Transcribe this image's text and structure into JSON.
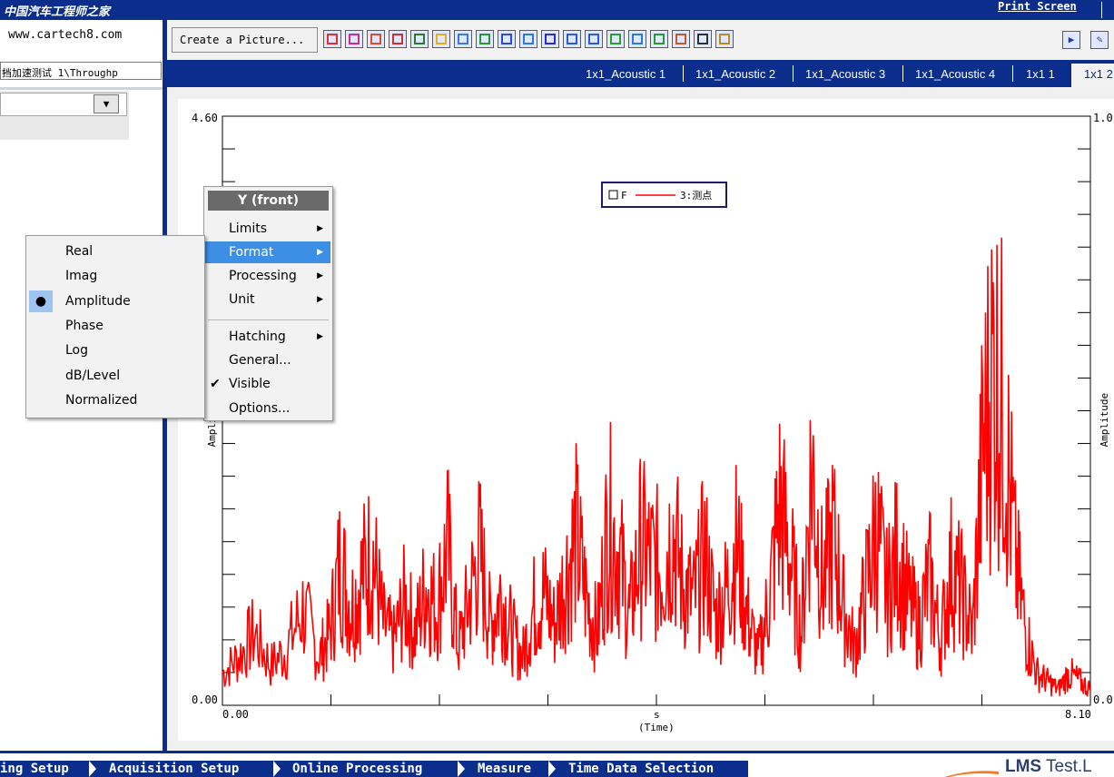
{
  "header": {
    "logo_text": "中国汽车工程师之家",
    "print_screen_label": "Print Screen"
  },
  "left_panel": {
    "site_url": "www.cartech8.com",
    "project_select_value": "挡加速测试 1\\Throughp"
  },
  "toolbar": {
    "create_picture_label": "Create a Picture...",
    "icons": [
      "line-graph-icon",
      "graph-2-icon",
      "circle-graph-icon",
      "polar-icon",
      "image-icon",
      "bar-3d-icon",
      "waterfall-icon",
      "list-icon",
      "flag-icon",
      "value-icon",
      "grid-icon",
      "axis-icon",
      "axis-2-icon",
      "palette-icon",
      "gauge-icon",
      "bar-chart-icon",
      "tools-icon",
      "bus-icon",
      "brush-icon"
    ],
    "right_icons": [
      "play-icon",
      "new-window-icon"
    ]
  },
  "tabs": [
    {
      "label": "1x1_Acoustic 1"
    },
    {
      "label": "1x1_Acoustic 2"
    },
    {
      "label": "1x1_Acoustic 3"
    },
    {
      "label": "1x1_Acoustic 4"
    },
    {
      "label": "1x1 1"
    },
    {
      "label": "1x1 2",
      "active": true
    }
  ],
  "chart_data": {
    "type": "line",
    "title": "",
    "xlabel_unit": "s",
    "xlabel": "(Time)",
    "ylabel": "Amplitude",
    "ylabel_right": "Amplitude",
    "x_tick_labels": [
      "0.00",
      "8.10"
    ],
    "y_tick_labels": [
      "0.00",
      "4.60"
    ],
    "y_right_tick_labels": [
      "0.0",
      "1.0"
    ],
    "xlim": [
      0,
      8.1
    ],
    "ylim": [
      0,
      4.6
    ],
    "grid": false,
    "legend_position": "top-center",
    "series": [
      {
        "name": "3:测点",
        "legend_prefix": "F",
        "color": "#ff0000",
        "x": [
          0,
          0.15,
          0.3,
          0.45,
          0.6,
          0.75,
          0.9,
          1.0,
          1.1,
          1.2,
          1.3,
          1.4,
          1.5,
          1.6,
          1.7,
          1.8,
          1.9,
          2.0,
          2.1,
          2.2,
          2.3,
          2.4,
          2.5,
          2.6,
          2.7,
          2.8,
          2.9,
          3.0,
          3.1,
          3.2,
          3.3,
          3.4,
          3.5,
          3.6,
          3.7,
          3.8,
          3.9,
          4.0,
          4.1,
          4.2,
          4.3,
          4.4,
          4.5,
          4.6,
          4.7,
          4.8,
          4.9,
          5.0,
          5.1,
          5.2,
          5.3,
          5.4,
          5.5,
          5.6,
          5.7,
          5.8,
          5.9,
          6.0,
          6.1,
          6.2,
          6.3,
          6.4,
          6.5,
          6.6,
          6.7,
          6.8,
          6.9,
          7.0,
          7.1,
          7.2,
          7.3,
          7.4,
          7.5,
          7.6,
          7.7,
          7.8,
          7.9,
          8.0,
          8.1
        ],
        "y": [
          0.4,
          0.6,
          0.9,
          0.5,
          0.7,
          1.2,
          0.6,
          0.9,
          1.8,
          1.2,
          1.6,
          1.9,
          1.0,
          0.8,
          1.3,
          0.9,
          1.5,
          1.2,
          2.0,
          0.7,
          1.3,
          1.9,
          1.0,
          1.4,
          0.9,
          0.6,
          1.2,
          1.4,
          1.0,
          1.6,
          2.1,
          1.3,
          0.9,
          2.3,
          1.9,
          1.1,
          2.0,
          1.8,
          1.7,
          2.2,
          1.5,
          1.3,
          1.9,
          1.1,
          1.4,
          2.0,
          1.1,
          0.6,
          1.3,
          2.5,
          1.8,
          0.9,
          3.0,
          1.5,
          2.1,
          1.2,
          0.7,
          1.4,
          2.2,
          1.4,
          1.9,
          1.3,
          1.0,
          1.6,
          0.8,
          1.7,
          1.4,
          0.9,
          3.3,
          4.3,
          3.5,
          1.8,
          0.9,
          0.4,
          0.3,
          0.2,
          0.4,
          0.3,
          0.2
        ]
      }
    ]
  },
  "context_menu": {
    "header": "Y (front)",
    "items": [
      {
        "label": "Limits",
        "submenu": true
      },
      {
        "label": "Format",
        "submenu": true,
        "highlighted": true
      },
      {
        "label": "Processing",
        "submenu": true
      },
      {
        "label": "Unit",
        "submenu": true
      },
      {
        "label": "Hatching",
        "submenu": true
      },
      {
        "label": "General..."
      },
      {
        "label": "Visible",
        "checked": true
      },
      {
        "label": "Options..."
      }
    ]
  },
  "format_submenu": {
    "items": [
      {
        "label": "Real"
      },
      {
        "label": "Imag"
      },
      {
        "label": "Amplitude",
        "selected": true
      },
      {
        "label": "Phase"
      },
      {
        "label": "Log"
      },
      {
        "label": "dB/Level"
      },
      {
        "label": "Normalized"
      }
    ]
  },
  "workflow": {
    "steps": [
      "ing Setup",
      "Acquisition Setup",
      "Online Processing",
      "Measure",
      "Time Data Selection"
    ]
  },
  "branding": {
    "product_bold": "LMS",
    "product_rest": " Test.L"
  }
}
